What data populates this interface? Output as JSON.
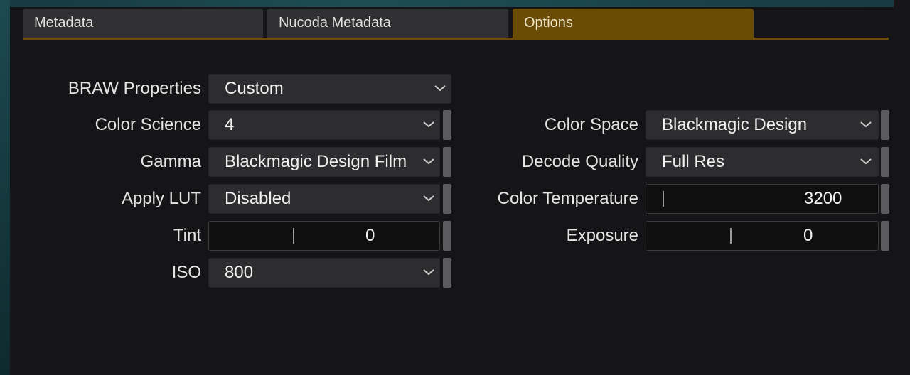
{
  "tabs": [
    {
      "label": "Metadata",
      "active": false
    },
    {
      "label": "Nucoda Metadata",
      "active": false
    },
    {
      "label": "Options",
      "active": true
    }
  ],
  "colors": {
    "accent": "#6a4c06",
    "panel": "#151517",
    "control": "#2d2d2f"
  },
  "left": {
    "braw_properties": {
      "label": "BRAW Properties",
      "value": "Custom"
    },
    "color_science": {
      "label": "Color Science",
      "value": "4"
    },
    "gamma": {
      "label": "Gamma",
      "value": "Blackmagic Design Film"
    },
    "apply_lut": {
      "label": "Apply LUT",
      "value": "Disabled"
    },
    "tint": {
      "label": "Tint",
      "value": "0"
    },
    "iso": {
      "label": "ISO",
      "value": "800"
    }
  },
  "right": {
    "color_space": {
      "label": "Color Space",
      "value": "Blackmagic Design"
    },
    "decode_quality": {
      "label": "Decode Quality",
      "value": "Full Res"
    },
    "color_temperature": {
      "label": "Color Temperature",
      "value": "3200"
    },
    "exposure": {
      "label": "Exposure",
      "value": "0"
    }
  },
  "icons": {
    "dropdown": "chevron-down-icon"
  }
}
